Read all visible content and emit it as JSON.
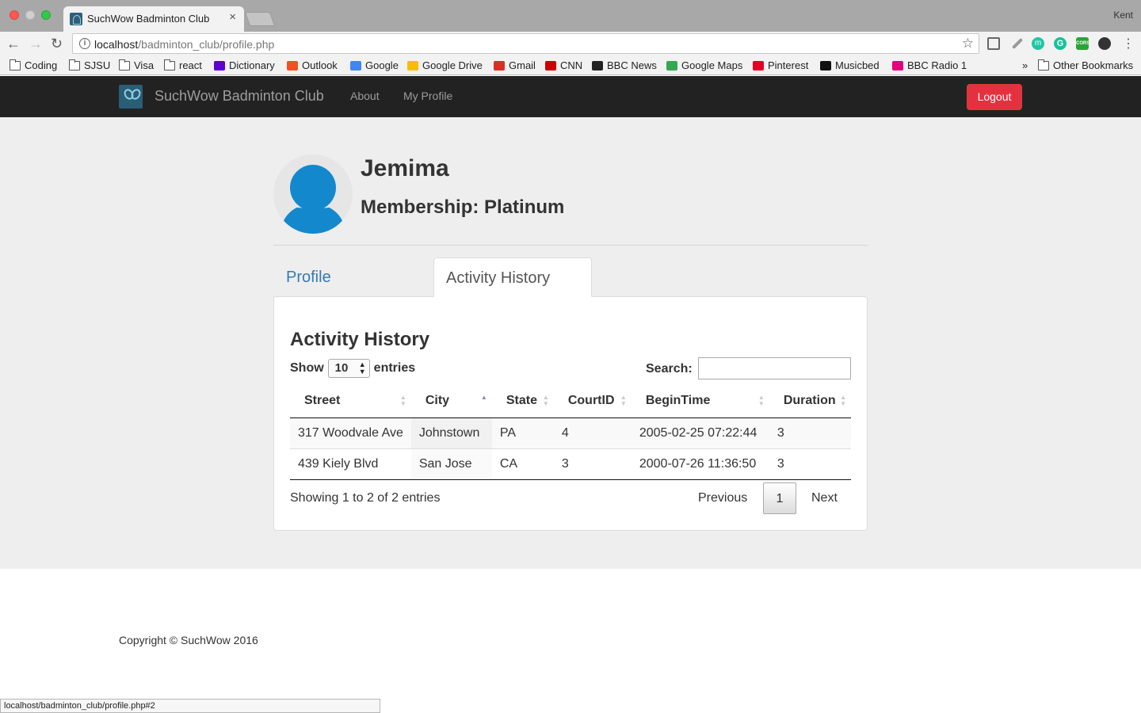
{
  "browser": {
    "tab_title": "SuchWow Badminton Club",
    "profile_name": "Kent",
    "url_host": "localhost",
    "url_path": "/badminton_club/profile.php",
    "status_url": "localhost/badminton_club/profile.php#2",
    "bookmarks": [
      {
        "label": "Coding",
        "icon": "folder-icon"
      },
      {
        "label": "SJSU",
        "icon": "folder-icon"
      },
      {
        "label": "Visa",
        "icon": "folder-icon"
      },
      {
        "label": "react",
        "icon": "folder-icon"
      },
      {
        "label": "Dictionary",
        "icon": "yahoo-icon",
        "color": "#5f01d1"
      },
      {
        "label": "Outlook",
        "icon": "outlook-icon",
        "color": "#f25022"
      },
      {
        "label": "Google",
        "icon": "google-icon",
        "color": "#4285f4"
      },
      {
        "label": "Google Drive",
        "icon": "drive-icon",
        "color": "#fbbc04"
      },
      {
        "label": "Gmail",
        "icon": "gmail-icon",
        "color": "#d93025"
      },
      {
        "label": "CNN",
        "icon": "cnn-icon",
        "color": "#cc0000"
      },
      {
        "label": "BBC News",
        "icon": "bbc-icon",
        "color": "#222222"
      },
      {
        "label": "Google Maps",
        "icon": "maps-icon",
        "color": "#34a853"
      },
      {
        "label": "Pinterest",
        "icon": "pinterest-icon",
        "color": "#e60023"
      },
      {
        "label": "Musicbed",
        "icon": "musicbed-icon",
        "color": "#111111"
      },
      {
        "label": "BBC Radio 1",
        "icon": "radio-icon",
        "color": "#e5007d"
      }
    ],
    "overflow": "»",
    "other_bookmarks": "Other Bookmarks"
  },
  "navbar": {
    "brand": "SuchWow Badminton Club",
    "links": [
      "About",
      "My Profile"
    ],
    "logout": "Logout",
    "logout_color": "#e5313f"
  },
  "profile": {
    "name": "Jemima",
    "membership": "Membership: Platinum"
  },
  "tabs": [
    {
      "label": "Profile",
      "active": false
    },
    {
      "label": "Activity History",
      "active": true
    }
  ],
  "history": {
    "title": "Activity History",
    "show_label": "Show",
    "page_length": "10",
    "entries_label": "entries",
    "search_label": "Search:",
    "search_value": "",
    "columns": [
      "Street",
      "City",
      "State",
      "CourtID",
      "BeginTime",
      "Duration"
    ],
    "sorted_column": "City",
    "rows": [
      [
        "317 Woodvale Ave",
        "Johnstown",
        "PA",
        "4",
        "2005-02-25 07:22:44",
        "3"
      ],
      [
        "439 Kiely Blvd",
        "San Jose",
        "CA",
        "3",
        "2000-07-26 11:36:50",
        "3"
      ]
    ],
    "info": "Showing 1 to 2 of 2 entries",
    "prev": "Previous",
    "page": "1",
    "next": "Next"
  },
  "footer": {
    "copyright": "Copyright © SuchWow 2016"
  }
}
